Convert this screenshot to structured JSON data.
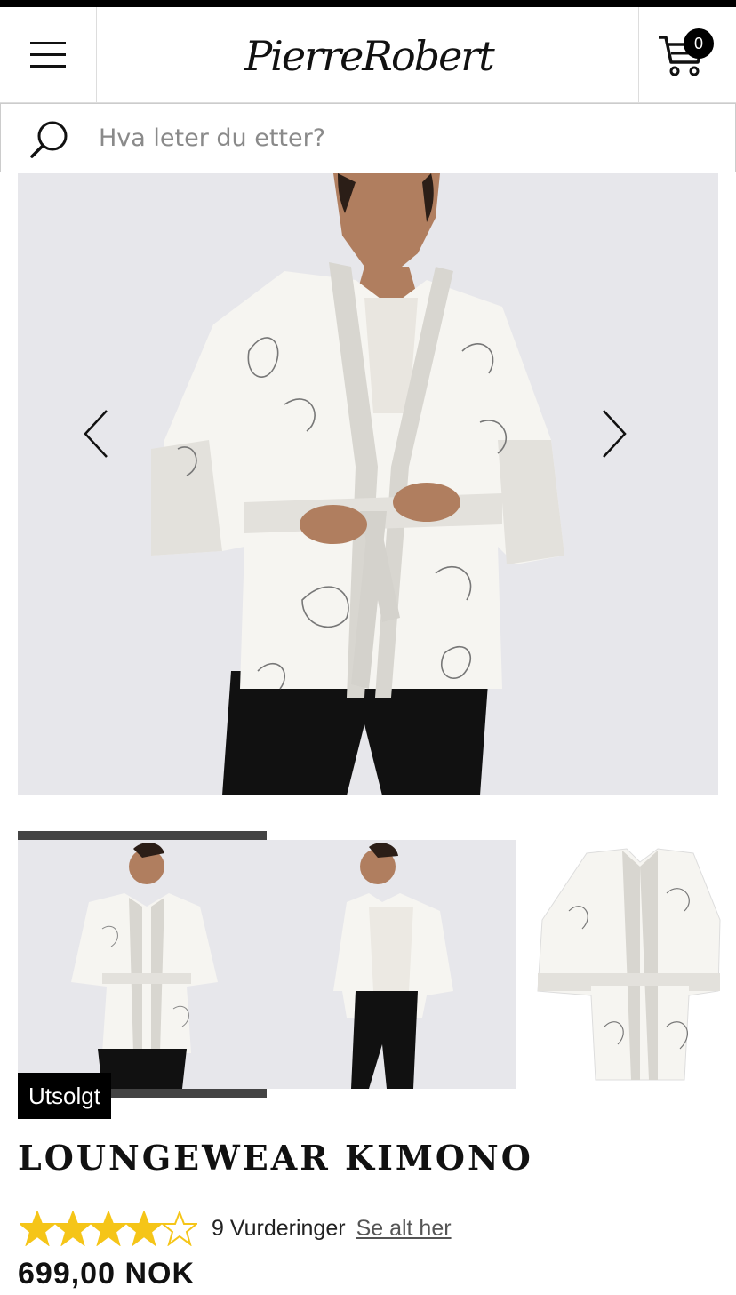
{
  "header": {
    "logo_text": "PierreRobert",
    "cart_count": "0"
  },
  "search": {
    "placeholder": "Hva leter du etter?"
  },
  "product": {
    "sold_badge": "Utsolgt",
    "title": "LOUNGEWEAR KIMONO",
    "rating_value": 4,
    "rating_max": 5,
    "rating_count_label": "9 Vurderinger",
    "reviews_link": "Se alt her",
    "price": "699,00 NOK"
  },
  "gallery": {
    "selected_thumbnail": 1,
    "thumbnail_count": 3
  },
  "colors": {
    "star": "#f5c518",
    "background": "#e7e7eb",
    "selection_bar": "#444444"
  }
}
